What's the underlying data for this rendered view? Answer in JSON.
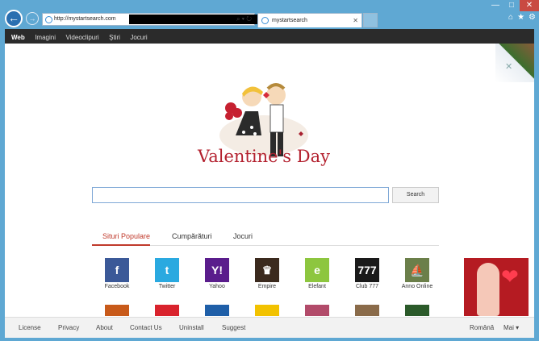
{
  "browser": {
    "url": "http://mystartsearch.com",
    "tab_title": "mystartsearch",
    "address_controls": "⌕ ▾ ↻"
  },
  "site_nav": [
    "Web",
    "Imagini",
    "Videoclipuri",
    "Ştiri",
    "Jocuri"
  ],
  "logo": {
    "text": "Valentine's Day"
  },
  "search": {
    "button": "Search",
    "value": ""
  },
  "tabs": [
    "Situri Populare",
    "Cumpărături",
    "Jocuri"
  ],
  "tiles": [
    {
      "label": "Facebook",
      "icon": "facebook-icon",
      "glyph": "f",
      "color": "#3b5998"
    },
    {
      "label": "Twitter",
      "icon": "twitter-icon",
      "glyph": "t",
      "color": "#2aa9e0"
    },
    {
      "label": "Yahoo",
      "icon": "yahoo-icon",
      "glyph": "Y!",
      "color": "#5a1d8c"
    },
    {
      "label": "Empire",
      "icon": "empire-icon",
      "glyph": "♛",
      "color": "#3b2a1e"
    },
    {
      "label": "Elefant",
      "icon": "elefant-icon",
      "glyph": "e",
      "color": "#8dc63f"
    },
    {
      "label": "Club 777",
      "icon": "club777-icon",
      "glyph": "777",
      "color": "#1a1a1a"
    },
    {
      "label": "Anno Online",
      "icon": "anno-online-icon",
      "glyph": "⛵",
      "color": "#6b7f4a"
    }
  ],
  "tiles_row2": [
    {
      "icon": "game-icon",
      "color": "#c85a1a"
    },
    {
      "icon": "emag-icon",
      "color": "#d9232d"
    },
    {
      "icon": "p-icon",
      "color": "#1f5fa8"
    },
    {
      "icon": "star-icon",
      "color": "#f2c200"
    },
    {
      "icon": "heart-game-icon",
      "color": "#b24b6a"
    },
    {
      "icon": "portrait-icon",
      "color": "#8a6b4a"
    },
    {
      "icon": "pay-icon",
      "color": "#2b5a2a"
    }
  ],
  "footer": {
    "links": [
      "License",
      "Privacy",
      "About",
      "Contact Us",
      "Uninstall",
      "Suggest"
    ],
    "language": "Română",
    "more": "Mai ▾"
  }
}
